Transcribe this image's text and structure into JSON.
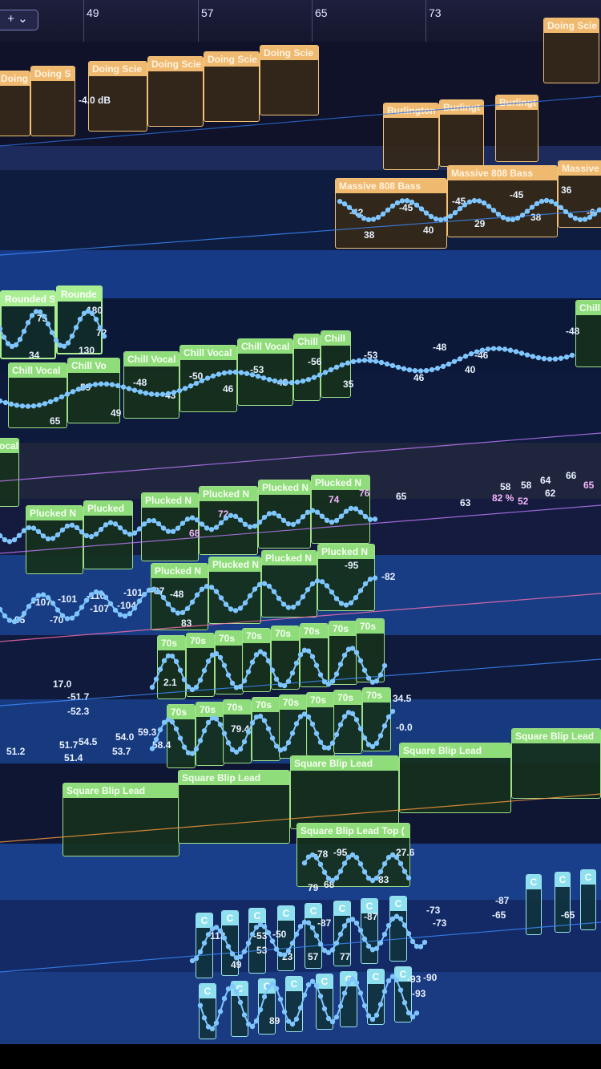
{
  "toolbar": {
    "add_track_label": "+ ⌄"
  },
  "ruler": {
    "bars": [
      "49",
      "57",
      "65",
      "73"
    ]
  },
  "regions": {
    "doing_science": "Doing Scie",
    "doing_s": "Doing S",
    "burlington": "Burlington",
    "burlingt": "Burlingt",
    "massive_808": "Massive 808 Bass",
    "massive": "Massive",
    "rounded_s": "Rounded S",
    "rounde": "Rounde",
    "chill_vocal": "Chill Vocal",
    "chill_vo": "Chill Vo",
    "chill": "Chill",
    "vocal": "ocal",
    "plucked_n": "Plucked N",
    "plucked": "Plucked",
    "seventies": "70s",
    "square_blip_lead": "Square Blip Lead",
    "square_blip_lead_top": "Square Blip Lead Top (",
    "c_clip": "C"
  },
  "automation": {
    "gain_db": "-4.0 dB",
    "bass": [
      "-42",
      "-45",
      "38",
      "40",
      "-45",
      "-45",
      "29",
      "38",
      "36",
      "-6"
    ],
    "rounded": [
      "75",
      "180",
      "72",
      "34",
      "130"
    ],
    "vocal_lane": [
      "-59",
      "-48",
      "-50",
      "-53",
      "-56",
      "-53",
      "-48",
      "-46",
      "-48",
      "46",
      "40",
      "43",
      "46",
      "48",
      "65",
      "49",
      "35"
    ],
    "plucked_top": [
      "76",
      "74",
      "72",
      "68",
      "65",
      "63",
      "58",
      "58",
      "64",
      "66",
      "52",
      "62",
      "82 %",
      "65"
    ],
    "plucked_low": [
      "-107",
      "-101",
      "-110",
      "-101",
      "-95",
      "-70",
      "-107",
      "-104",
      "-87",
      "-48",
      "83",
      "-95",
      "-82"
    ],
    "seventies_a": [
      "17.0",
      "-51.7",
      "-52.3",
      "2.1",
      "34.5"
    ],
    "seventies_b": [
      "51.2",
      "51.7",
      "54.5",
      "51.4",
      "54.0",
      "59.3",
      "53.7",
      "58.4",
      "79.4",
      "-0.0"
    ],
    "square_top": [
      "-78",
      "-95",
      "27.6",
      "79",
      "68",
      "83"
    ],
    "c_lane": [
      "-113",
      "-53",
      "-50",
      "-87",
      "-87",
      "-73",
      "-73",
      "-65",
      "-87",
      "-65",
      "49",
      "53",
      "23",
      "57",
      "77",
      "89",
      "-93",
      "-90",
      "-93"
    ]
  },
  "colors": {
    "orange_region": "#f0b970",
    "green_region": "#8fdc7a",
    "cyan_region": "#8fe0ee",
    "automation_node": "#7fc6ff",
    "volume_line_pink": "#c07cff",
    "track_lane_blue": "#1a3f8a"
  }
}
